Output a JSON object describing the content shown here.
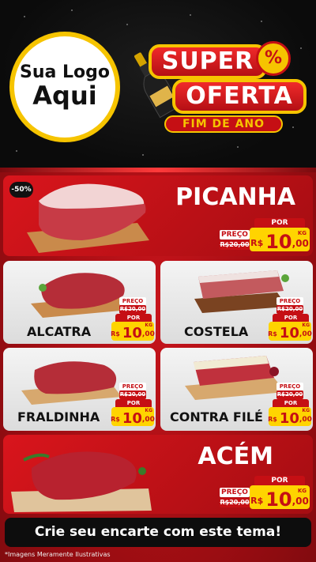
{
  "header": {
    "logo_line1": "Sua Logo",
    "logo_line2": "Aqui",
    "title_super": "SUPER",
    "title_oferta": "OFERTA",
    "percent_icon": "%",
    "subtitle": "FIM DE ANO"
  },
  "colors": {
    "brand_red": "#c50f14",
    "brand_yellow": "#ffd400",
    "header_black": "#0b0b0b"
  },
  "products": [
    {
      "name": "PICANHA",
      "preco_label": "PREÇO",
      "old_price": "R$20,00",
      "por_label": "POR",
      "currency": "R$",
      "price_int": "10",
      "price_cents": ",00",
      "unit": "KG",
      "badge": "-50%"
    },
    {
      "name": "ALCATRA",
      "preco_label": "PREÇO",
      "old_price": "R$20,00",
      "por_label": "POR",
      "currency": "R$",
      "price_int": "10",
      "price_cents": ",00",
      "unit": "KG"
    },
    {
      "name": "COSTELA",
      "preco_label": "PREÇO",
      "old_price": "R$20,00",
      "por_label": "POR",
      "currency": "R$",
      "price_int": "10",
      "price_cents": ",00",
      "unit": "KG"
    },
    {
      "name": "FRALDINHA",
      "preco_label": "PREÇO",
      "old_price": "R$20,00",
      "por_label": "POR",
      "currency": "R$",
      "price_int": "10",
      "price_cents": ",00",
      "unit": "KG"
    },
    {
      "name": "CONTRA FILÉ",
      "preco_label": "PREÇO",
      "old_price": "R$20,00",
      "por_label": "POR",
      "currency": "R$",
      "price_int": "10",
      "price_cents": ",00",
      "unit": "KG"
    },
    {
      "name": "ACÉM",
      "preco_label": "PREÇO",
      "old_price": "R$20,00",
      "por_label": "POR",
      "currency": "R$",
      "price_int": "10",
      "price_cents": ",00",
      "unit": "KG"
    }
  ],
  "cta_text": "Crie seu encarte com este tema!",
  "footnote": "*Imagens Meramente Ilustrativas"
}
